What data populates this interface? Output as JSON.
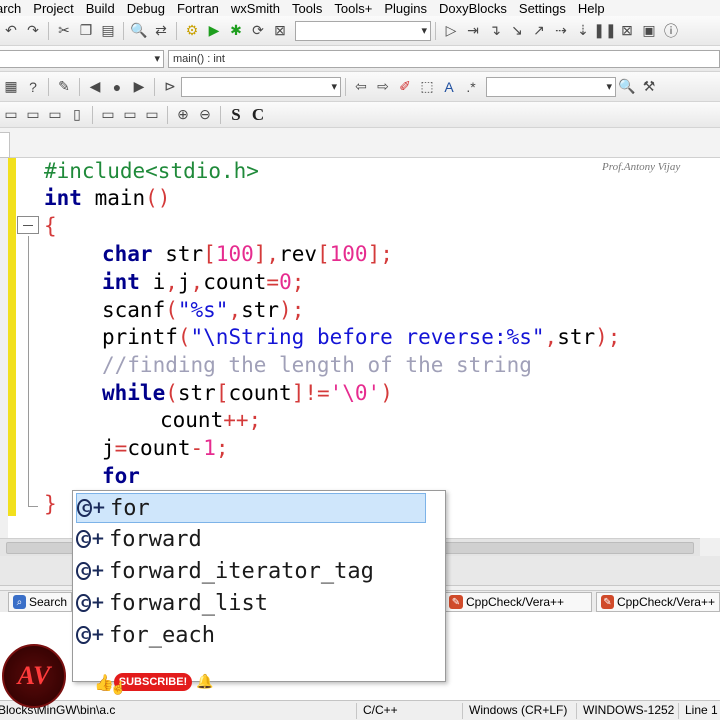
{
  "menu": [
    "arch",
    "Project",
    "Build",
    "Debug",
    "Fortran",
    "wxSmith",
    "Tools",
    "Tools+",
    "Plugins",
    "DoxyBlocks",
    "Settings",
    "Help"
  ],
  "toolbar2": {
    "function_scope": "main() : int"
  },
  "toolbar4": {
    "s_button": "S",
    "c_button": "C"
  },
  "editor": {
    "watermark": "Prof.Antony Vijay",
    "lines": {
      "l1a": "#include",
      "l1b": "<stdio.h>",
      "l2a": "int",
      "l2b": " main",
      "l2c": "()",
      "l3": "{",
      "l4a": "char",
      "l4b": " str",
      "l4c": "[",
      "l4d": "100",
      "l4e": "],",
      "l4f": "rev",
      "l4g": "[",
      "l4h": "100",
      "l4i": "];",
      "l5a": "int",
      "l5b": " i",
      "l5c": ",",
      "l5d": "j",
      "l5e": ",",
      "l5f": "count",
      "l5g": "=",
      "l5h": "0",
      "l5i": ";",
      "l6a": "scanf",
      "l6b": "(",
      "l6c": "\"%s\"",
      "l6d": ",",
      "l6e": "str",
      "l6f": ");",
      "l7a": "printf",
      "l7b": "(",
      "l7c": "\"\\nString before reverse:%s\"",
      "l7d": ",",
      "l7e": "str",
      "l7f": ");",
      "l8": "//finding the length of the string",
      "l9a": "while",
      "l9b": "(",
      "l9c": "str",
      "l9d": "[",
      "l9e": "count",
      "l9f": "]!=",
      "l9g": "'\\0'",
      "l9h": ")",
      "l10a": "count",
      "l10b": "++;",
      "l11a": "j",
      "l11b": "=",
      "l11c": "count",
      "l11d": "-",
      "l11e": "1",
      "l11f": ";",
      "l12": "for",
      "l13": "}"
    }
  },
  "autocomplete": [
    "for",
    "forward",
    "forward_iterator_tag",
    "forward_list",
    "for_each"
  ],
  "log_tabs": {
    "search": "Search",
    "cppcheck1": "CppCheck/Vera++",
    "cppcheck2": "CppCheck/Vera++"
  },
  "status": {
    "path": "Blocks\\MinGW\\bin\\a.c",
    "lang": "C/C++",
    "eol": "Windows (CR+LF)",
    "encoding": "WINDOWS-1252",
    "line": "Line 1"
  },
  "overlay": {
    "subscribe": "SUBSCRIBE!",
    "logo": "AV"
  },
  "colors": {
    "keyword": "#00008b",
    "preprocessor": "#1f8a3a",
    "number": "#e62c8f",
    "string": "#1414d6",
    "comment": "#a0a0b8",
    "selection": "#cfe6fb",
    "change_bar": "#f2e01d"
  }
}
